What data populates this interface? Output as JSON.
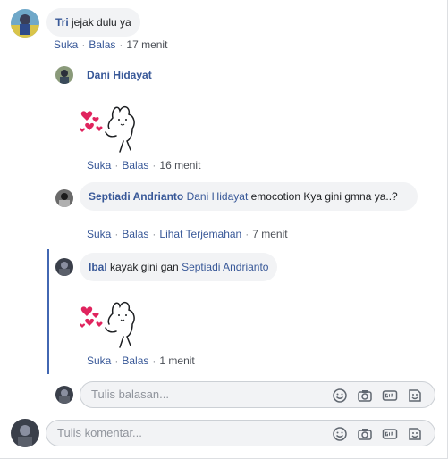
{
  "actions": {
    "like": "Suka",
    "reply": "Balas",
    "translate": "Lihat Terjemahan"
  },
  "comments": [
    {
      "author": "Tri",
      "text": "jejak dulu ya",
      "time": "17 menit"
    },
    {
      "author": "Dani Hidayat",
      "time": "16 menit"
    },
    {
      "author": "Septiadi Andrianto",
      "mention": "Dani Hidayat",
      "text": "emocotion Kya gini gmna ya..?",
      "time": "7 menit"
    },
    {
      "author": "Ibal",
      "text": "kayak gini gan",
      "mention": "Septiadi Andrianto",
      "time": "1 menit"
    }
  ],
  "reply_box": {
    "placeholder": "Tulis balasan..."
  },
  "comment_box": {
    "placeholder": "Tulis komentar..."
  },
  "icons": [
    "emoji-icon",
    "camera-icon",
    "gif-icon",
    "sticker-icon"
  ],
  "colors": {
    "link": "#385898",
    "bubble": "#f2f3f5",
    "thread_line": "#4267b2",
    "heart": "#e0245e"
  }
}
